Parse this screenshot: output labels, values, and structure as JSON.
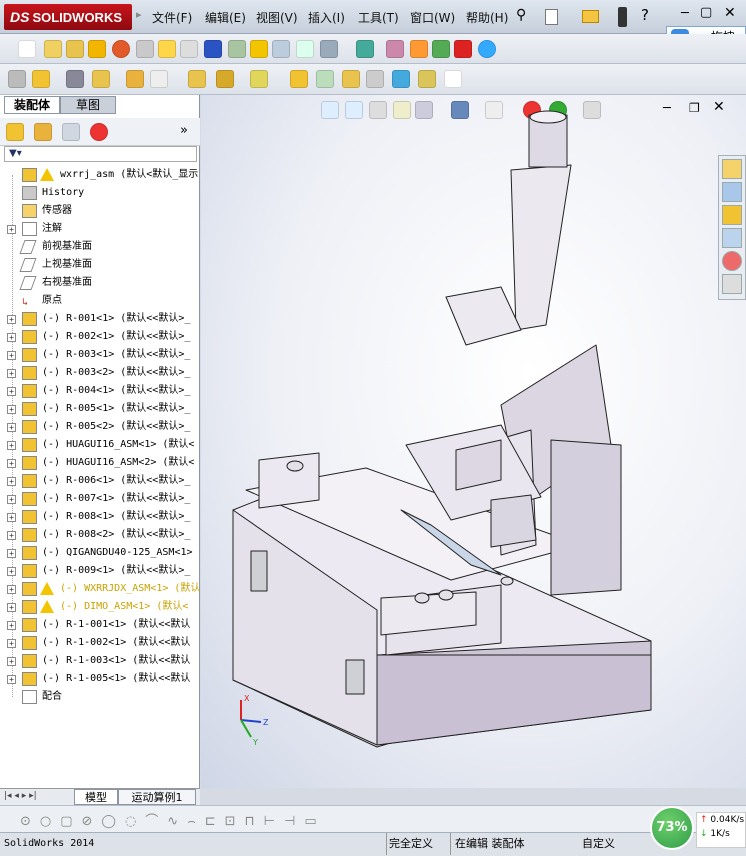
{
  "app": {
    "logo": "SOLIDWORKS",
    "logo_prefix": "DS"
  },
  "menu": [
    "文件(F)",
    "编辑(E)",
    "视图(V)",
    "插入(I)",
    "工具(T)",
    "窗口(W)",
    "帮助(H)"
  ],
  "drag_button": "拖拽上",
  "panel_tabs": [
    "装配体",
    "草图"
  ],
  "tree": [
    {
      "label": "wxrrj_asm  (默认<默认_显示",
      "icon": "asm",
      "warn": true,
      "expand": false
    },
    {
      "label": "History",
      "icon": "history",
      "expand": false
    },
    {
      "label": "传感器",
      "icon": "sensor",
      "expand": false
    },
    {
      "label": "注解",
      "icon": "annot",
      "expand": true
    },
    {
      "label": "前视基准面",
      "icon": "plane",
      "expand": false
    },
    {
      "label": "上视基准面",
      "icon": "plane",
      "expand": false
    },
    {
      "label": "右视基准面",
      "icon": "plane",
      "expand": false
    },
    {
      "label": "原点",
      "icon": "origin",
      "expand": false
    },
    {
      "label": "(-) R-001<1>  (默认<<默认>_",
      "icon": "part",
      "expand": true
    },
    {
      "label": "(-) R-002<1>  (默认<<默认>_",
      "icon": "part",
      "expand": true
    },
    {
      "label": "(-) R-003<1>  (默认<<默认>_",
      "icon": "part",
      "expand": true
    },
    {
      "label": "(-) R-003<2>  (默认<<默认>_",
      "icon": "part",
      "expand": true
    },
    {
      "label": "(-) R-004<1>  (默认<<默认>_",
      "icon": "part",
      "expand": true
    },
    {
      "label": "(-) R-005<1>  (默认<<默认>_",
      "icon": "part",
      "expand": true
    },
    {
      "label": "(-) R-005<2>  (默认<<默认>_",
      "icon": "part",
      "expand": true
    },
    {
      "label": "(-) HUAGUI16_ASM<1>  (默认<",
      "icon": "asm",
      "expand": true
    },
    {
      "label": "(-) HUAGUI16_ASM<2>  (默认<",
      "icon": "asm",
      "expand": true
    },
    {
      "label": "(-) R-006<1>  (默认<<默认>_",
      "icon": "part",
      "expand": true
    },
    {
      "label": "(-) R-007<1>  (默认<<默认>_",
      "icon": "part",
      "expand": true
    },
    {
      "label": "(-) R-008<1>  (默认<<默认>_",
      "icon": "part",
      "expand": true
    },
    {
      "label": "(-) R-008<2>  (默认<<默认>_",
      "icon": "part",
      "expand": true
    },
    {
      "label": "(-) QIGANGDU40-125_ASM<1>",
      "icon": "asm",
      "expand": true
    },
    {
      "label": "(-) R-009<1>  (默认<<默认>_",
      "icon": "part",
      "expand": true
    },
    {
      "label": "(-) WXRRJDX_ASM<1>  (默认",
      "icon": "asm",
      "warn": true,
      "yellow": true,
      "expand": true
    },
    {
      "label": "(-) DIMO_ASM<1>  (默认<",
      "icon": "asm",
      "warn": true,
      "yellow": true,
      "expand": true
    },
    {
      "label": "(-) R-1-001<1>  (默认<<默认",
      "icon": "part",
      "expand": true
    },
    {
      "label": "(-) R-1-002<1>  (默认<<默认",
      "icon": "part",
      "expand": true
    },
    {
      "label": "(-) R-1-003<1>  (默认<<默认",
      "icon": "part",
      "expand": true
    },
    {
      "label": "(-) R-1-005<1>  (默认<<默认",
      "icon": "part",
      "expand": true
    },
    {
      "label": "配合",
      "icon": "mate",
      "expand": false
    }
  ],
  "bottom_tabs": [
    "模型",
    "运动算例1"
  ],
  "status": {
    "app_version": "SolidWorks 2014",
    "state1": "完全定义",
    "state2": "在编辑 装配体",
    "state3": "自定义"
  },
  "net": {
    "percent": "73%",
    "up": "0.04K/s",
    "down": "1K/s"
  },
  "colors": {
    "accent": "#c8141c",
    "part_yellow": "#f1c232",
    "tree_yellow": "#c9a200",
    "net_green": "#2e9d4a"
  }
}
